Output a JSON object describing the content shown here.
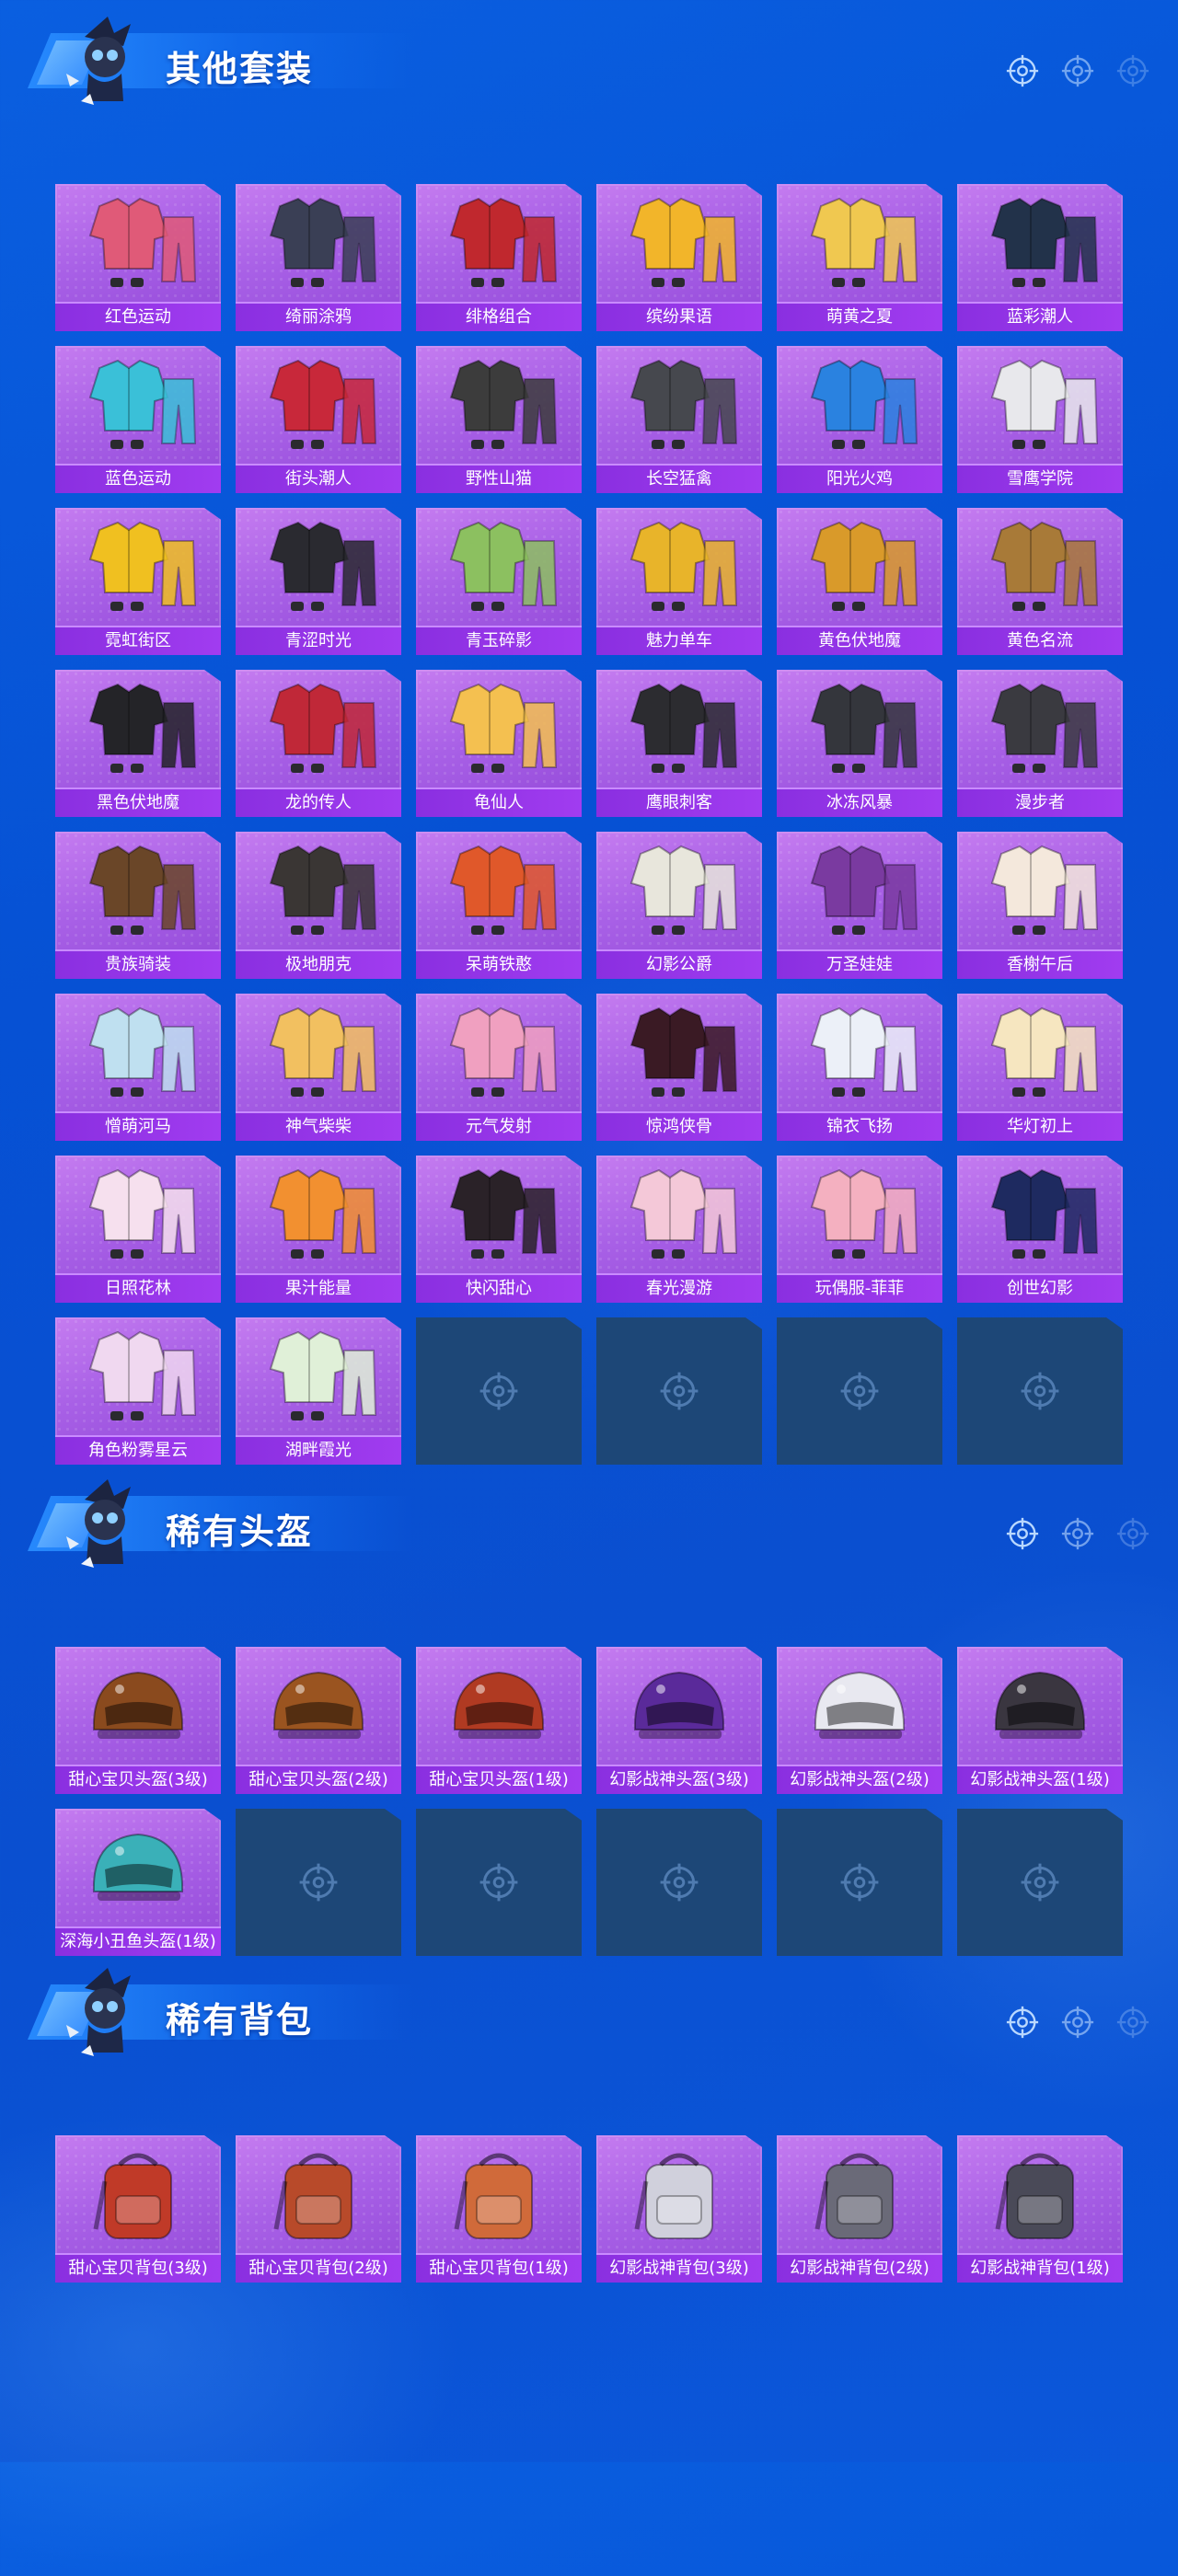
{
  "colors": {
    "background": "#0651d4",
    "tile": "#a860e6",
    "label_bar": "#9a36ea",
    "empty_tile": "#1d4777",
    "text": "#ffffff"
  },
  "sections": [
    {
      "id": "outfits",
      "title": "其他套装",
      "icon": "outfit-icon",
      "items": [
        {
          "label": "红色运动",
          "color": "#e05a78"
        },
        {
          "label": "绮丽涂鸦",
          "color": "#3a3f55"
        },
        {
          "label": "绯格组合",
          "color": "#c0282e"
        },
        {
          "label": "缤纷果语",
          "color": "#f2b52a"
        },
        {
          "label": "萌黄之夏",
          "color": "#f0c850"
        },
        {
          "label": "蓝彩潮人",
          "color": "#22324a"
        },
        {
          "label": "蓝色运动",
          "color": "#3ac0d8"
        },
        {
          "label": "街头潮人",
          "color": "#c8283a"
        },
        {
          "label": "野性山猫",
          "color": "#3c3c3c"
        },
        {
          "label": "长空猛禽",
          "color": "#46484e"
        },
        {
          "label": "阳光火鸡",
          "color": "#2a82e0"
        },
        {
          "label": "雪鹰学院",
          "color": "#e8e8ec"
        },
        {
          "label": "霓虹街区",
          "color": "#f0c020"
        },
        {
          "label": "青涩时光",
          "color": "#2a2a30"
        },
        {
          "label": "青玉碎影",
          "color": "#8cc060"
        },
        {
          "label": "魅力单车",
          "color": "#e8b42a"
        },
        {
          "label": "黄色伏地魔",
          "color": "#d99a2a"
        },
        {
          "label": "黄色名流",
          "color": "#a87a38"
        },
        {
          "label": "黑色伏地魔",
          "color": "#242428"
        },
        {
          "label": "龙的传人",
          "color": "#c02838"
        },
        {
          "label": "龟仙人",
          "color": "#f4c050"
        },
        {
          "label": "鹰眼刺客",
          "color": "#2c2c30"
        },
        {
          "label": "冰冻风暴",
          "color": "#34363c"
        },
        {
          "label": "漫步者",
          "color": "#3a3a40"
        },
        {
          "label": "贵族骑装",
          "color": "#6a4628"
        },
        {
          "label": "极地朋克",
          "color": "#3a3634"
        },
        {
          "label": "呆萌铁憨",
          "color": "#e0582a"
        },
        {
          "label": "幻影公爵",
          "color": "#e8e6dc"
        },
        {
          "label": "万圣娃娃",
          "color": "#7a3aa0"
        },
        {
          "label": "香榭午后",
          "color": "#f4e8dc"
        },
        {
          "label": "憎萌河马",
          "color": "#bfe0f0"
        },
        {
          "label": "神气柴柴",
          "color": "#f2c060"
        },
        {
          "label": "元气发射",
          "color": "#f0a0c0"
        },
        {
          "label": "惊鸿侠骨",
          "color": "#3a1a24"
        },
        {
          "label": "锦衣飞扬",
          "color": "#ecf0f8"
        },
        {
          "label": "华灯初上",
          "color": "#f6e6c0"
        },
        {
          "label": "日照花林",
          "color": "#f6e0ee"
        },
        {
          "label": "果汁能量",
          "color": "#f29030"
        },
        {
          "label": "快闪甜心",
          "color": "#2a2228"
        },
        {
          "label": "春光漫游",
          "color": "#f4c8d8"
        },
        {
          "label": "玩偶服-菲菲",
          "color": "#f4b0c0"
        },
        {
          "label": "创世幻影",
          "color": "#1e2a60"
        },
        {
          "label": "角色粉雾星云",
          "color": "#f0d8f0"
        },
        {
          "label": "湖畔霞光",
          "color": "#e0f0d8"
        }
      ],
      "empty_slots": 4
    },
    {
      "id": "helmets",
      "title": "稀有头盔",
      "icon": "helmet-icon",
      "items": [
        {
          "label": "甜心宝贝头盔(3级)",
          "color": "#8a4a1e"
        },
        {
          "label": "甜心宝贝头盔(2级)",
          "color": "#9a5420"
        },
        {
          "label": "甜心宝贝头盔(1级)",
          "color": "#b03a22"
        },
        {
          "label": "幻影战神头盔(3级)",
          "color": "#5a2a9a"
        },
        {
          "label": "幻影战神头盔(2级)",
          "color": "#e8e8f0"
        },
        {
          "label": "幻影战神头盔(1级)",
          "color": "#3a3640"
        },
        {
          "label": "深海小丑鱼头盔(1级)",
          "color": "#3ab0b8"
        }
      ],
      "empty_slots": 5
    },
    {
      "id": "backpacks",
      "title": "稀有背包",
      "icon": "backpack-icon",
      "items": [
        {
          "label": "甜心宝贝背包(3级)",
          "color": "#c03a28"
        },
        {
          "label": "甜心宝贝背包(2级)",
          "color": "#b84a2a"
        },
        {
          "label": "甜心宝贝背包(1级)",
          "color": "#d06a3a"
        },
        {
          "label": "幻影战神背包(3级)",
          "color": "#d0d0dc"
        },
        {
          "label": "幻影战神背包(2级)",
          "color": "#6a6a78"
        },
        {
          "label": "幻影战神背包(1级)",
          "color": "#4a4a58"
        }
      ],
      "empty_slots": 0
    }
  ]
}
